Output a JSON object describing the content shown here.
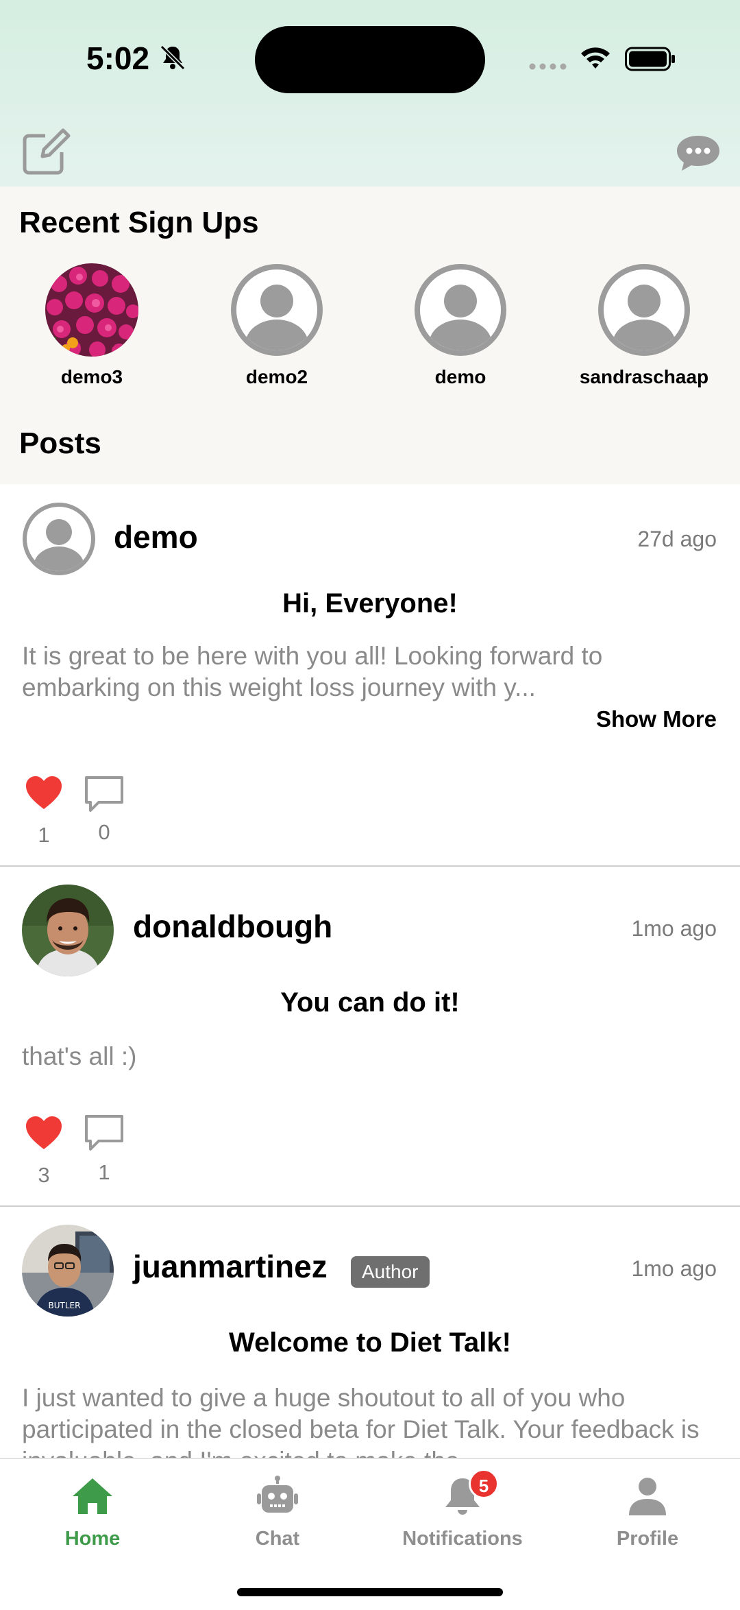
{
  "status_bar": {
    "time": "5:02"
  },
  "recent": {
    "title": "Recent Sign Ups",
    "users": [
      {
        "name": "demo3",
        "avatar": "flower-photo"
      },
      {
        "name": "demo2",
        "avatar": "default"
      },
      {
        "name": "demo",
        "avatar": "default"
      },
      {
        "name": "sandraschaap",
        "avatar": "default"
      }
    ]
  },
  "posts_title": "Posts",
  "posts": [
    {
      "user": "demo",
      "time": "27d ago",
      "title": "Hi, Everyone!",
      "body": "It is great to be here with you all! Looking forward to embarking on this weight loss journey with y...",
      "show_more": "Show More",
      "likes": "1",
      "comments": "0"
    },
    {
      "user": "donaldbough",
      "time": "1mo ago",
      "title": "You can do it!",
      "body": "that's all :)",
      "likes": "3",
      "comments": "1"
    },
    {
      "user": "juanmartinez",
      "badge": "Author",
      "time": "1mo ago",
      "title": "Welcome to Diet Talk!",
      "body": "I just wanted to give a huge shoutout to all of you who participated in the closed beta for Diet Talk. Your feedback is invaluable, and I'm excited to make the"
    }
  ],
  "tabs": [
    {
      "label": "Home",
      "icon": "home-icon",
      "active": true
    },
    {
      "label": "Chat",
      "icon": "robot-icon"
    },
    {
      "label": "Notifications",
      "icon": "bell-icon",
      "badge": "5"
    },
    {
      "label": "Profile",
      "icon": "person-icon"
    }
  ],
  "colors": {
    "accent": "#3e9b4a",
    "like": "#f03a35",
    "badge": "#e8332e"
  }
}
